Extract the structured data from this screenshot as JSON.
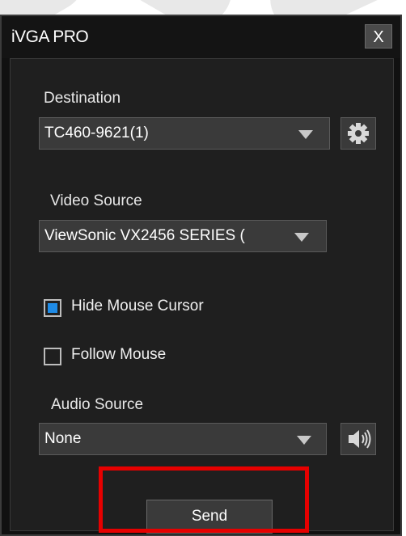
{
  "window": {
    "title": "iVGA PRO",
    "close_label": "X"
  },
  "destination": {
    "label": "Destination",
    "value": "TC460-9621(1)",
    "settings_icon": "gear-icon"
  },
  "video_source": {
    "label": "Video Source",
    "value": "ViewSonic VX2456 SERIES ("
  },
  "options": {
    "hide_mouse_cursor": {
      "label": "Hide Mouse Cursor",
      "checked": true
    },
    "follow_mouse": {
      "label": "Follow Mouse",
      "checked": false
    }
  },
  "audio_source": {
    "label": "Audio Source",
    "value": "None",
    "volume_icon": "speaker-icon"
  },
  "actions": {
    "send_label": "Send"
  },
  "colors": {
    "accent": "#1e8be6",
    "highlight": "#e60000"
  }
}
